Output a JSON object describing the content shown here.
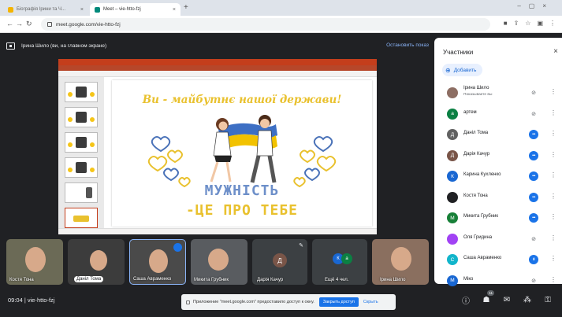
{
  "browser": {
    "tabs": [
      {
        "label": "Біографія Ірини та Ч...",
        "active": false,
        "color": "#f4b400"
      },
      {
        "label": "Meet – vie-htto-fzj",
        "active": true,
        "color": "#00897b"
      }
    ],
    "new_tab": "+",
    "url": "meet.google.com/vie-htto-fzj"
  },
  "meet": {
    "presenter_text": "Ірина Шило (ви, на главном экране)",
    "stop_presenting": "Остановить показ",
    "slide": {
      "title": "Ви - майбутнє нашої держави!",
      "line1": "МУЖНІСТЬ",
      "line2": "-ЦЕ ПРО ТЕБЕ"
    },
    "tiles": [
      {
        "name": "Костя Тона",
        "type": "video",
        "bg": "#6b6a56"
      },
      {
        "name": "Даніл Тома",
        "type": "video",
        "bg": "#3c3c3c"
      },
      {
        "name": "Саша Авраменко",
        "type": "video",
        "bg": "#4a4a4a",
        "pinned": true
      },
      {
        "name": "Микита Грубник",
        "type": "video",
        "bg": "#595c60"
      },
      {
        "name": "Дарія Качур",
        "type": "avatar",
        "initial": "Д",
        "bg": "#3c4043",
        "avatar_color": "#795548"
      },
      {
        "name": "Ещё 4 чел.",
        "type": "group",
        "bg": "#3c4043"
      },
      {
        "name": "Ірина Шило",
        "type": "video",
        "bg": "#8a6f5f"
      }
    ],
    "time_code": "09:04 | vie-htto-fzj",
    "notice": {
      "text": "Приложение \"meet.google.com\" предоставило доступ к окну.",
      "stop": "Закрыть доступ",
      "hide": "Скрыть"
    },
    "participants_badge": "11"
  },
  "panel": {
    "title": "Участники",
    "add_label": "Добавить",
    "people": [
      {
        "name": "Ірина Шило",
        "sub": "Показываете вы",
        "initial": "",
        "color": "#8d6e63",
        "mic": "off"
      },
      {
        "name": "артем",
        "sub": "",
        "initial": "а",
        "color": "#0b8043",
        "mic": "off"
      },
      {
        "name": "Даніл Тома",
        "sub": "",
        "initial": "Д",
        "color": "#616161",
        "mic": "on"
      },
      {
        "name": "Дарія Качур",
        "sub": "",
        "initial": "Д",
        "color": "#795548",
        "mic": "on"
      },
      {
        "name": "Карина Кухленко",
        "sub": "",
        "initial": "К",
        "color": "#1967d2",
        "mic": "on"
      },
      {
        "name": "Костя Тона",
        "sub": "",
        "initial": "",
        "color": "#202124",
        "mic": "on"
      },
      {
        "name": "Микита Грубник",
        "sub": "",
        "initial": "М",
        "color": "#188038",
        "mic": "on"
      },
      {
        "name": "Оля Гридина",
        "sub": "",
        "initial": "",
        "color": "#a142f4",
        "mic": "off"
      },
      {
        "name": "Саша Авраменко",
        "sub": "",
        "initial": "С",
        "color": "#12b5cb",
        "mic": "active"
      },
      {
        "name": "Міко",
        "sub": "",
        "initial": "М",
        "color": "#1967d2",
        "mic": "off"
      }
    ]
  }
}
